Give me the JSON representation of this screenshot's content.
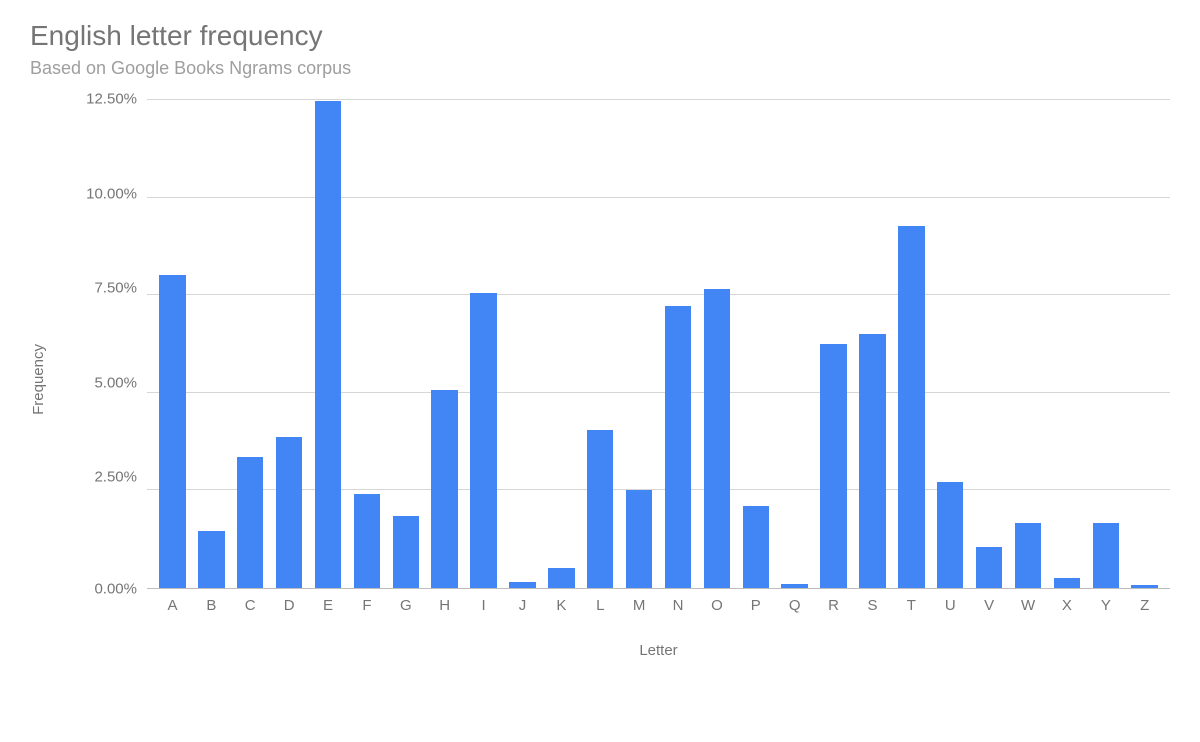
{
  "chart_data": {
    "type": "bar",
    "title": "English letter frequency",
    "subtitle": "Based on Google Books Ngrams corpus",
    "xlabel": "Letter",
    "ylabel": "Frequency",
    "ylim": [
      0,
      12.5
    ],
    "y_ticks": [
      "12.50%",
      "10.00%",
      "7.50%",
      "5.00%",
      "2.50%",
      "0.00%"
    ],
    "categories": [
      "A",
      "B",
      "C",
      "D",
      "E",
      "F",
      "G",
      "H",
      "I",
      "J",
      "K",
      "L",
      "M",
      "N",
      "O",
      "P",
      "Q",
      "R",
      "S",
      "T",
      "U",
      "V",
      "W",
      "X",
      "Y",
      "Z"
    ],
    "values": [
      8.0,
      1.45,
      3.35,
      3.85,
      12.45,
      2.4,
      1.85,
      5.05,
      7.55,
      0.15,
      0.5,
      4.05,
      2.5,
      7.2,
      7.65,
      2.1,
      0.1,
      6.25,
      6.5,
      9.25,
      2.7,
      1.05,
      1.65,
      0.25,
      1.65,
      0.08
    ],
    "bar_color": "#4285f4"
  }
}
